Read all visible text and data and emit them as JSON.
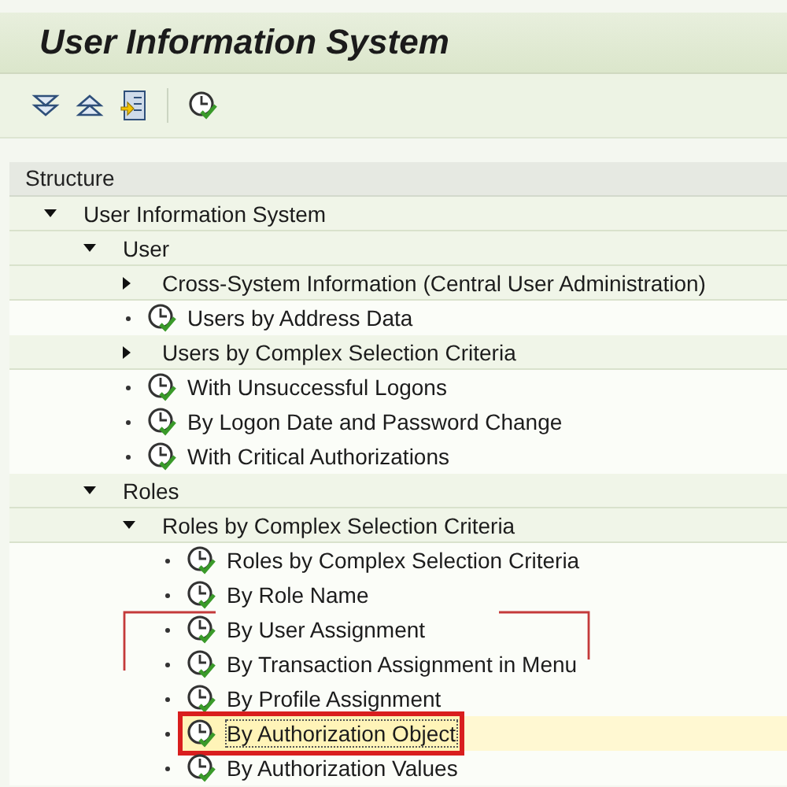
{
  "window": {
    "title": "User Information System"
  },
  "toolbar": [
    {
      "kind": "expand"
    },
    {
      "kind": "collapse"
    },
    {
      "kind": "document"
    },
    {
      "kind": "separator"
    },
    {
      "kind": "execute"
    }
  ],
  "tree": {
    "header": "Structure",
    "nodes": [
      {
        "kind": "folder",
        "label": "User Information System",
        "expanded": true,
        "selected": false,
        "children": [
          {
            "kind": "folder",
            "label": "User",
            "expanded": true,
            "selected": false,
            "children": [
              {
                "kind": "folder",
                "label": "Cross-System Information (Central User Administration)",
                "expanded": false,
                "selected": false
              },
              {
                "kind": "report",
                "label": "Users by Address Data",
                "selected": false
              },
              {
                "kind": "folder",
                "label": "Users by Complex Selection Criteria",
                "expanded": false,
                "selected": false
              },
              {
                "kind": "report",
                "label": "With Unsuccessful Logons",
                "selected": false
              },
              {
                "kind": "report",
                "label": "By Logon Date and Password Change",
                "selected": false
              },
              {
                "kind": "report",
                "label": "With Critical Authorizations",
                "selected": false
              }
            ]
          },
          {
            "kind": "folder",
            "label": "Roles",
            "expanded": true,
            "selected": false,
            "children": [
              {
                "kind": "folder",
                "label": "Roles by Complex Selection Criteria",
                "expanded": true,
                "selected": false,
                "children": [
                  {
                    "kind": "report",
                    "label": "Roles by Complex Selection Criteria",
                    "selected": false
                  },
                  {
                    "kind": "report",
                    "label": "By Role Name",
                    "selected": false
                  },
                  {
                    "kind": "report",
                    "label": "By User Assignment",
                    "selected": false
                  },
                  {
                    "kind": "report",
                    "label": "By Transaction Assignment in Menu",
                    "selected": false
                  },
                  {
                    "kind": "report",
                    "label": "By Profile Assignment",
                    "selected": false
                  },
                  {
                    "kind": "report",
                    "label": "By Authorization Object",
                    "selected": true
                  },
                  {
                    "kind": "report",
                    "label": "By Authorization Values",
                    "selected": false
                  }
                ]
              }
            ]
          }
        ]
      }
    ]
  }
}
